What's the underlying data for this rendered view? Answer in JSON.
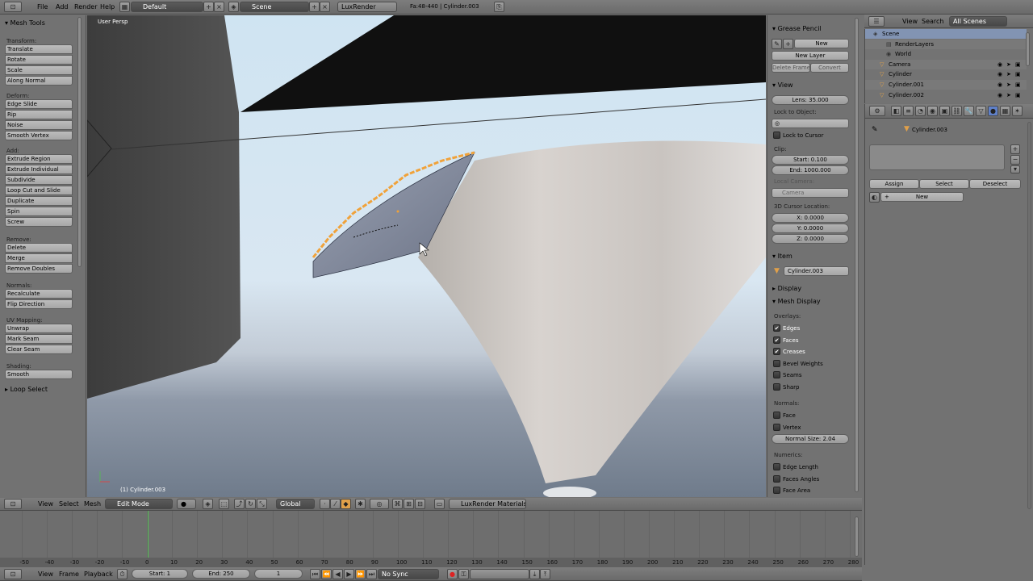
{
  "topbar": {
    "menus": [
      "File",
      "Add",
      "Render",
      "Help"
    ],
    "screen_layout": "Default",
    "scene": "Scene",
    "render_engine": "LuxRender",
    "stats": "Fa:48-440 | Cylinder.003"
  },
  "tool_shelf": {
    "title": "Mesh Tools",
    "sections": [
      {
        "label": "Transform:",
        "buttons": [
          "Translate",
          "Rotate",
          "Scale",
          "Along Normal"
        ]
      },
      {
        "label": "Deform:",
        "buttons": [
          "Edge Slide",
          "Rip",
          "Noise",
          "Smooth Vertex"
        ]
      },
      {
        "label": "Add:",
        "buttons": [
          "Extrude Region",
          "Extrude Individual",
          "Subdivide",
          "Loop Cut and Slide",
          "Duplicate",
          "Spin",
          "Screw"
        ]
      },
      {
        "label": "Remove:",
        "buttons": [
          "Delete",
          "Merge",
          "Remove Doubles"
        ]
      },
      {
        "label": "Normals:",
        "buttons": [
          "Recalculate",
          "Flip Direction"
        ]
      },
      {
        "label": "UV Mapping:",
        "buttons": [
          "Unwrap",
          "Mark Seam",
          "Clear Seam"
        ]
      },
      {
        "label": "Shading:",
        "buttons": [
          "Smooth"
        ]
      }
    ],
    "operator_panel": "Loop Select"
  },
  "viewport": {
    "view_label": "User Persp",
    "object_label": "(1) Cylinder.003"
  },
  "properties_shelf": {
    "grease_pencil": {
      "title": "Grease Pencil",
      "new_button": "New",
      "new_layer": "New Layer",
      "delete_frame": "Delete Frame",
      "convert": "Convert"
    },
    "view": {
      "title": "View",
      "lens": "Lens: 35.000",
      "lock_to_object": "Lock to Object:",
      "lock_to_cursor": "Lock to Cursor",
      "clip": "Clip:",
      "clip_start": "Start: 0.100",
      "clip_end": "End: 1000.000",
      "local_camera": "Local Camera:",
      "camera": "Camera",
      "cursor_location": "3D Cursor Location:",
      "cx": "X: 0.0000",
      "cy": "Y: 0.0000",
      "cz": "Z: 0.0000"
    },
    "item": {
      "title": "Item",
      "name": "Cylinder.003"
    },
    "display": {
      "title": "Display"
    },
    "mesh_display": {
      "title": "Mesh Display",
      "overlays_label": "Overlays:",
      "overlays": [
        {
          "label": "Edges",
          "checked": true
        },
        {
          "label": "Faces",
          "checked": true
        },
        {
          "label": "Creases",
          "checked": true
        },
        {
          "label": "Bevel Weights",
          "checked": false
        },
        {
          "label": "Seams",
          "checked": false
        },
        {
          "label": "Sharp",
          "checked": false
        }
      ],
      "normals_label": "Normals:",
      "normals": [
        {
          "label": "Face",
          "checked": false
        },
        {
          "label": "Vertex",
          "checked": false
        }
      ],
      "normal_size": "Normal Size: 2.04",
      "numerics_label": "Numerics:",
      "numerics": [
        {
          "label": "Edge Length",
          "checked": false
        },
        {
          "label": "Faces Angles",
          "checked": false
        },
        {
          "label": "Face Area",
          "checked": false
        }
      ]
    }
  },
  "outliner": {
    "menus": [
      "View",
      "Search"
    ],
    "filter": "All Scenes",
    "items": [
      "Scene",
      "RenderLayers",
      "World",
      "Camera",
      "Cylinder",
      "Cylinder.001",
      "Cylinder.002"
    ]
  },
  "properties_editor": {
    "breadcrumb": "Cylinder.003",
    "buttons": [
      "Assign",
      "Select",
      "Deselect"
    ],
    "new_button": "New"
  },
  "viewport_header": {
    "menus": [
      "View",
      "Select",
      "Mesh"
    ],
    "mode": "Edit Mode",
    "orientation": "Global",
    "materials": "LuxRender Materials"
  },
  "timeline": {
    "ticks": [
      "-50",
      "-40",
      "-30",
      "-20",
      "-10",
      "0",
      "10",
      "20",
      "30",
      "40",
      "50",
      "60",
      "70",
      "80",
      "90",
      "100",
      "110",
      "120",
      "130",
      "140",
      "150",
      "160",
      "170",
      "180",
      "190",
      "200",
      "210",
      "220",
      "230",
      "240",
      "250",
      "260",
      "270",
      "280"
    ],
    "current_frame": 1
  },
  "timeline_header": {
    "menus": [
      "View",
      "Frame",
      "Playback"
    ],
    "start": "Start: 1",
    "end": "End: 250",
    "frame": "1",
    "sync": "No Sync"
  }
}
